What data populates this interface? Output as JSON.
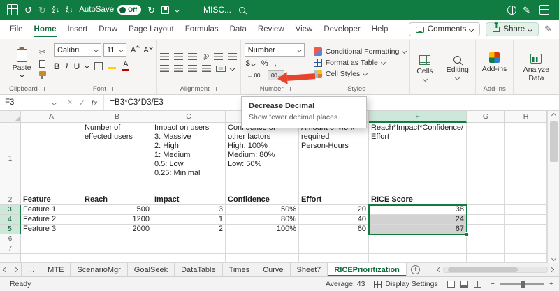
{
  "colors": {
    "excel_green": "#107C41",
    "selection_fill": "#d2d2d2",
    "selected_header_bg": "#cde8da",
    "annotation_arrow_red": "#e8432b"
  },
  "title_bar": {
    "autosave_label": "AutoSave",
    "autosave_state": "Off",
    "document_title": "MISC..."
  },
  "tabs_row": {
    "tabs": [
      "File",
      "Home",
      "Insert",
      "Draw",
      "Page Layout",
      "Formulas",
      "Data",
      "Review",
      "View",
      "Developer",
      "Help"
    ],
    "active_tab": "Home",
    "comments_label": "Comments",
    "share_label": "Share"
  },
  "ribbon": {
    "paste_label": "Paste",
    "clipboard_group_label": "Clipboard",
    "font_name": "Calibri",
    "font_size": "11",
    "bold_label": "B",
    "italic_label": "I",
    "underline_label": "U",
    "font_letter": "A",
    "orientation_glyph": "ab",
    "font_group_label": "Font",
    "alignment_group_label": "Alignment",
    "number_format": "Number",
    "currency_label": "$",
    "percent_label": "%",
    "comma_label": ",",
    "increase_decimal_glyph": "←.00",
    "decrease_decimal_glyph": ".00→",
    "number_group_label": "Number",
    "conditional_formatting_label": "Conditional Formatting",
    "format_as_table_label": "Format as Table",
    "cell_styles_label": "Cell Styles",
    "styles_group_label": "Styles",
    "cells_label": "Cells",
    "editing_label": "Editing",
    "addins_label": "Add-ins",
    "addins_group_label": "Add-ins",
    "analyze_data_label": "Analyze Data"
  },
  "tooltip": {
    "title": "Decrease Decimal",
    "description": "Show fewer decimal places."
  },
  "formula_bar": {
    "cell_reference": "F3",
    "fx_label": "fx",
    "formula": "=B3*C3*D3/E3"
  },
  "grid": {
    "column_headers": [
      "A",
      "B",
      "C",
      "D",
      "E",
      "F",
      "G",
      "H"
    ],
    "selected_column": "F",
    "selected_range": "F3:F5",
    "rows": [
      {
        "num": "1",
        "cells": {
          "B": "Number of\neffected users",
          "C": "Impact on users\n3: Massive\n2: High\n1: Medium\n0.5: Low\n0.25: Minimal",
          "D": "Confidence of\nother factors\nHigh: 100%\nMedium: 80%\nLow: 50%",
          "E": "Amount of work\nrequired\nPerson-Hours",
          "F": "Reach*Impact*Confidence/\nEffort"
        }
      },
      {
        "num": "2",
        "cells": {
          "A": "Feature",
          "B": "Reach",
          "C": "Impact",
          "D": "Confidence",
          "E": "Effort",
          "F": "RICE Score"
        }
      },
      {
        "num": "3",
        "cells": {
          "A": "Feature 1",
          "B": "500",
          "C": "3",
          "D": "50%",
          "E": "20",
          "F": "38"
        }
      },
      {
        "num": "4",
        "cells": {
          "A": "Feature 2",
          "B": "1200",
          "C": "1",
          "D": "80%",
          "E": "40",
          "F": "24"
        }
      },
      {
        "num": "5",
        "cells": {
          "A": "Feature 3",
          "B": "2000",
          "C": "2",
          "D": "100%",
          "E": "60",
          "F": "67"
        }
      },
      {
        "num": "6",
        "cells": {}
      },
      {
        "num": "7",
        "cells": {}
      }
    ]
  },
  "sheet_tabs": {
    "overflow_indicator": "...",
    "tabs": [
      "MTE",
      "ScenarioMgr",
      "GoalSeek",
      "DataTable",
      "Times",
      "Curve",
      "Sheet7",
      "RICEPrioritization"
    ],
    "active_tab": "RICEPrioritization"
  },
  "status_bar": {
    "ready_label": "Ready",
    "average_label": "Average: 43",
    "display_settings_label": "Display Settings"
  }
}
